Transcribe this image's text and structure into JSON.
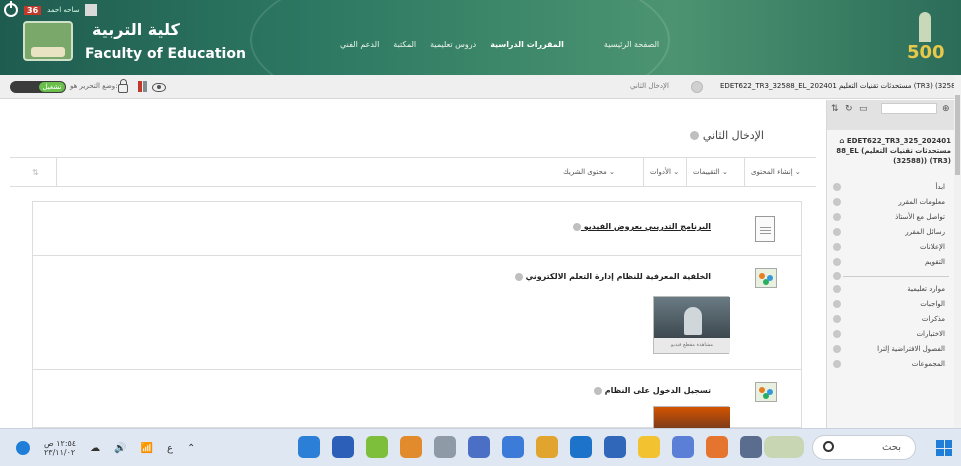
{
  "header": {
    "status_count": "36",
    "user_mini": "ساحه احمد",
    "college_ar": "كلية التربية",
    "college_en": "Faculty of Education",
    "nav": [
      "الدعم الفني",
      "المكتبة",
      "دروس تعليمية",
      "المقررات الدراسية",
      "الصفحة الرئيسية"
    ],
    "logo_number": "500"
  },
  "crumbbar": {
    "edit_label": "وضع التحرير هو:",
    "edit_state": "تشغيل",
    "current_page": "الإدخال الثاني",
    "course_path": "EDET622_TR3_32588_EL_202401 مستحدثات تقنيات التعليم (TR3) (32588)"
  },
  "main": {
    "page_title": "الإدخال الثاني",
    "toolbar": {
      "build_content": "إنشاء المحتوى",
      "assessments": "التقييمات",
      "tools": "الأدوات",
      "partner_content": "محتوى الشريك"
    },
    "items": [
      {
        "title": "البرنامج التدريبي بعروض الفيديو",
        "icon": "document-icon"
      },
      {
        "title": "الخلفية المعرفية للنظام إدارة التعلم الالكتروني",
        "icon": "people-icon",
        "video_caption": "مشاهدة مقطع فيديو"
      },
      {
        "title": "تسجيل الدخول على النظام",
        "icon": "people-icon"
      }
    ]
  },
  "sidebar": {
    "course_title": "EDET622_TR3_325_202401 88_EL (مستحدثات تقنيات التعليم ((32588) (TR3)",
    "items": [
      "ابدأ",
      "معلومات المقرر",
      "تواصل مع الأستاذ",
      "رسائل المقرر",
      "الإعلانات",
      "التقويم",
      "---",
      "موارد تعليمية",
      "الواجبات",
      "مذكرات",
      "الاختبارات",
      "الفصول الافتراضية إلترا",
      "المجموعات"
    ]
  },
  "taskbar": {
    "search_placeholder": "بحث",
    "time": "١٢:٥٤ ص",
    "date": "٢٣/١١/٠٢"
  }
}
